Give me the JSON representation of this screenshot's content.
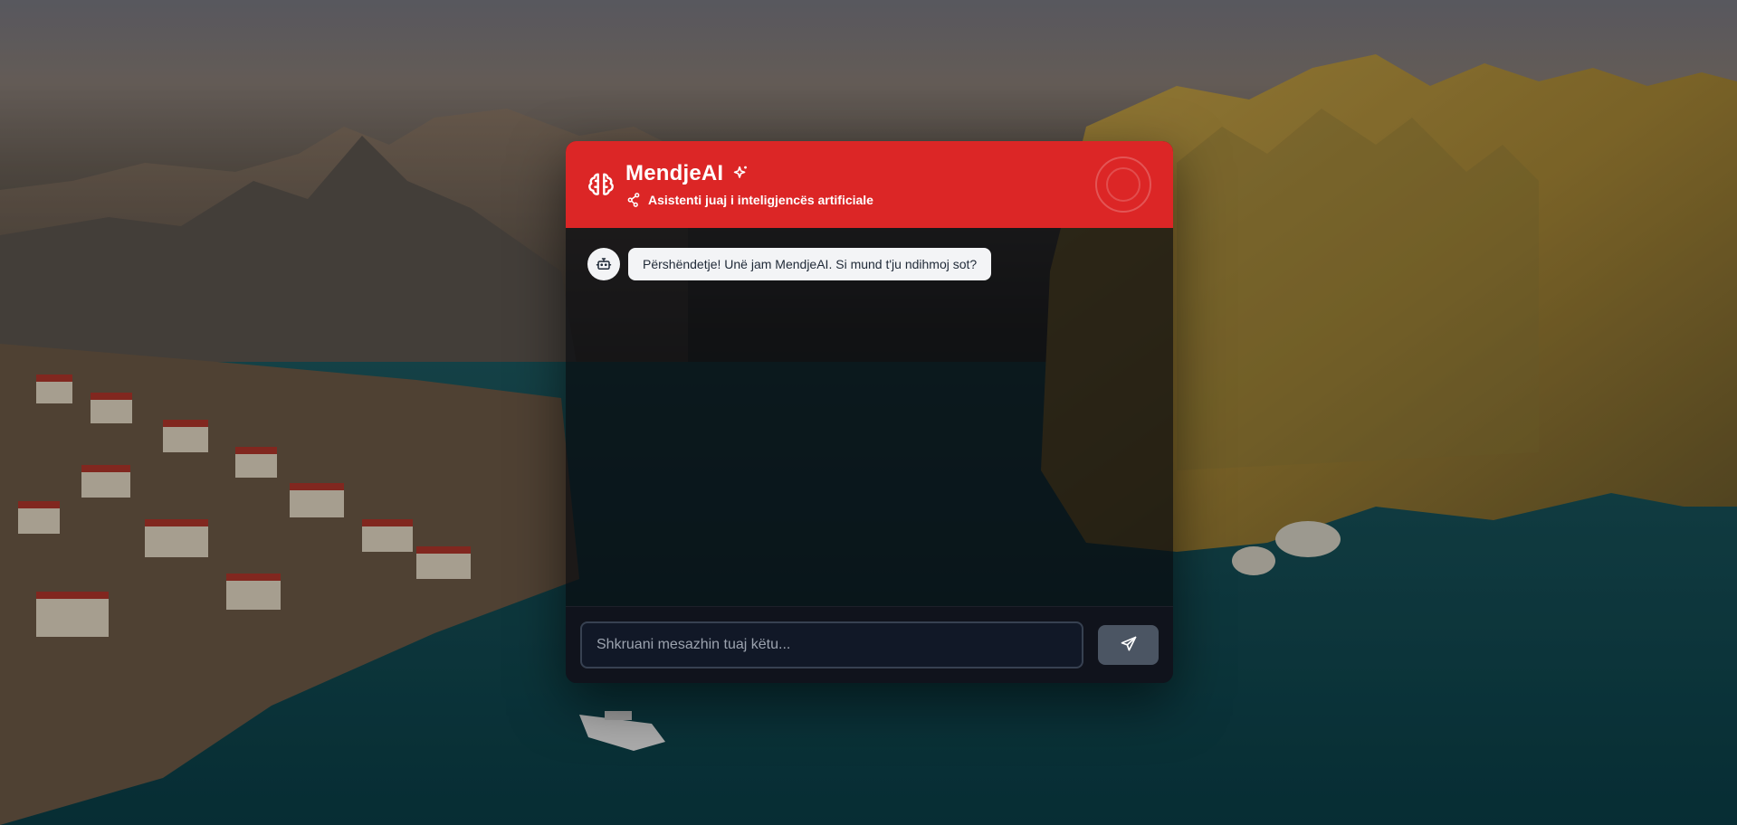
{
  "header": {
    "title": "MendjeAI",
    "subtitle": "Asistenti juaj i inteligjencës artificiale",
    "accent_color": "#dc2626",
    "icons": [
      "brain-icon",
      "sparkle-icon",
      "network-icon"
    ]
  },
  "messages": [
    {
      "sender": "bot",
      "avatar_icon": "robot-icon",
      "text": "Përshëndetje! Unë jam MendjeAI. Si mund t'ju ndihmoj sot?"
    }
  ],
  "composer": {
    "placeholder": "Shkruani mesazhin tuaj këtu...",
    "value": "",
    "send_icon": "send-icon"
  }
}
